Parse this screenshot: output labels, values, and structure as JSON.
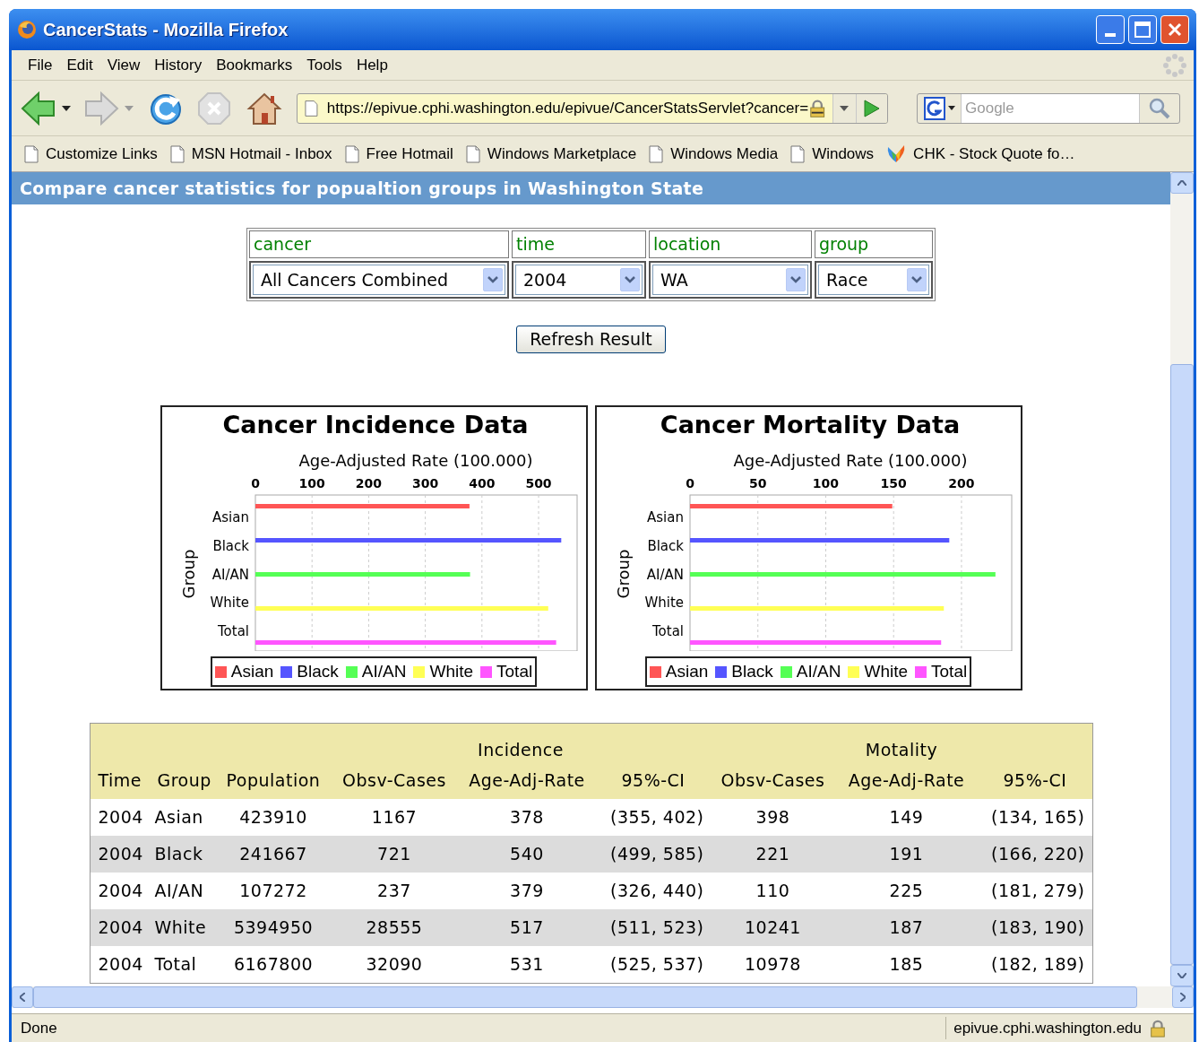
{
  "window": {
    "title": "CancerStats - Mozilla Firefox"
  },
  "menu": [
    "File",
    "Edit",
    "View",
    "History",
    "Bookmarks",
    "Tools",
    "Help"
  ],
  "toolbar": {
    "url": "https://epivue.cphi.washington.edu/epivue/CancerStatsServlet?cancer=",
    "search_placeholder": "Google"
  },
  "bookmarks": [
    {
      "label": "Customize Links",
      "kind": "page"
    },
    {
      "label": "MSN Hotmail - Inbox",
      "kind": "page"
    },
    {
      "label": "Free Hotmail",
      "kind": "page"
    },
    {
      "label": "Windows Marketplace",
      "kind": "page"
    },
    {
      "label": "Windows Media",
      "kind": "page"
    },
    {
      "label": "Windows",
      "kind": "page"
    },
    {
      "label": "CHK - Stock Quote fo…",
      "kind": "butterfly"
    }
  ],
  "page": {
    "heading": "Compare cancer statistics for popualtion groups in Washington State",
    "filters": [
      {
        "label": "cancer",
        "value": "All Cancers Combined"
      },
      {
        "label": "time",
        "value": "2004"
      },
      {
        "label": "location",
        "value": "WA"
      },
      {
        "label": "group",
        "value": "Race"
      }
    ],
    "button": "Refresh Result",
    "charts": [
      {
        "chart_data": {
          "type": "bar",
          "orientation": "horizontal",
          "title": "Cancer Incidence Data",
          "xlabel": "Age-Adjusted Rate (100.000)",
          "ylabel": "Group",
          "categories": [
            "Asian",
            "Black",
            "AI/AN",
            "White",
            "Total"
          ],
          "series": [
            {
              "name": "Asian",
              "color": "#ff5555",
              "values": [
                378,
                null,
                null,
                null,
                null
              ]
            },
            {
              "name": "Black",
              "color": "#5555ff",
              "values": [
                null,
                540,
                null,
                null,
                null
              ]
            },
            {
              "name": "AI/AN",
              "color": "#55ff55",
              "values": [
                null,
                null,
                379,
                null,
                null
              ]
            },
            {
              "name": "White",
              "color": "#ffff55",
              "values": [
                null,
                null,
                null,
                517,
                null
              ]
            },
            {
              "name": "Total",
              "color": "#ff55ff",
              "values": [
                null,
                null,
                null,
                null,
                531
              ]
            }
          ],
          "xlim": [
            0,
            568
          ],
          "xticks": [
            0,
            100,
            200,
            300,
            400,
            500
          ],
          "grid": true,
          "legend": "bottom"
        }
      },
      {
        "chart_data": {
          "type": "bar",
          "orientation": "horizontal",
          "title": "Cancer Mortality Data",
          "xlabel": "Age-Adjusted Rate (100.000)",
          "ylabel": "Group",
          "categories": [
            "Asian",
            "Black",
            "AI/AN",
            "White",
            "Total"
          ],
          "series": [
            {
              "name": "Asian",
              "color": "#ff5555",
              "values": [
                149,
                null,
                null,
                null,
                null
              ]
            },
            {
              "name": "Black",
              "color": "#5555ff",
              "values": [
                null,
                191,
                null,
                null,
                null
              ]
            },
            {
              "name": "AI/AN",
              "color": "#55ff55",
              "values": [
                null,
                null,
                225,
                null,
                null
              ]
            },
            {
              "name": "White",
              "color": "#ffff55",
              "values": [
                null,
                null,
                null,
                187,
                null
              ]
            },
            {
              "name": "Total",
              "color": "#ff55ff",
              "values": [
                null,
                null,
                null,
                null,
                185
              ]
            }
          ],
          "xlim": [
            0,
            237
          ],
          "xticks": [
            0,
            50,
            100,
            150,
            200
          ],
          "grid": true,
          "legend": "bottom"
        }
      }
    ],
    "table": {
      "group_headers": [
        "Incidence",
        "Motality"
      ],
      "columns": [
        "Time",
        "Group",
        "Population",
        "Obsv-Cases",
        "Age-Adj-Rate",
        "95%-CI",
        "Obsv-Cases",
        "Age-Adj-Rate",
        "95%-CI"
      ],
      "rows": [
        [
          "2004",
          "Asian",
          "423910",
          "1167",
          "378",
          "(355, 402)",
          "398",
          "149",
          "(134, 165)"
        ],
        [
          "2004",
          "Black",
          "241667",
          "721",
          "540",
          "(499, 585)",
          "221",
          "191",
          "(166, 220)"
        ],
        [
          "2004",
          "AI/AN",
          "107272",
          "237",
          "379",
          "(326, 440)",
          "110",
          "225",
          "(181, 279)"
        ],
        [
          "2004",
          "White",
          "5394950",
          "28555",
          "517",
          "(511, 523)",
          "10241",
          "187",
          "(183, 190)"
        ],
        [
          "2004",
          "Total",
          "6167800",
          "32090",
          "531",
          "(525, 537)",
          "10978",
          "185",
          "(182, 189)"
        ]
      ]
    }
  },
  "status_bar": {
    "text": "Done",
    "host": "epivue.cphi.washington.edu"
  }
}
